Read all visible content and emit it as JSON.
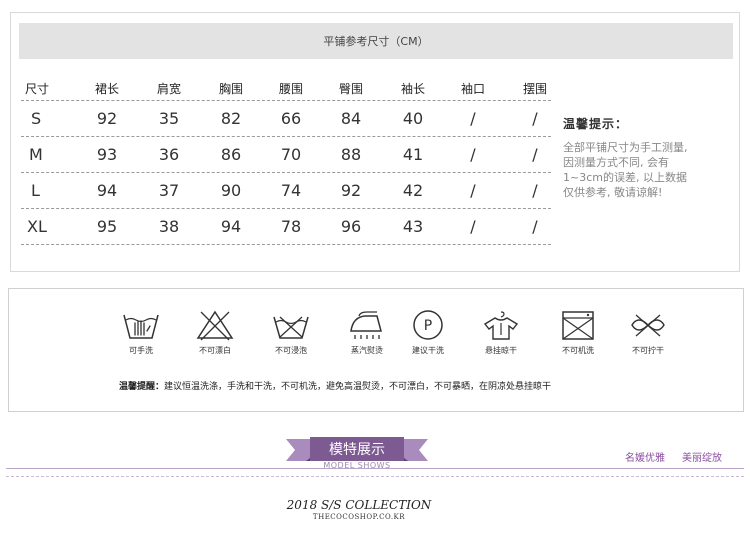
{
  "size_chart": {
    "title": "平铺参考尺寸（CM）",
    "headers": [
      "尺寸",
      "裙长",
      "肩宽",
      "胸围",
      "腰围",
      "臀围",
      "袖长",
      "袖口",
      "摆围"
    ],
    "rows": [
      [
        "S",
        "92",
        "35",
        "82",
        "66",
        "84",
        "40",
        "/",
        "/"
      ],
      [
        "M",
        "93",
        "36",
        "86",
        "70",
        "88",
        "41",
        "/",
        "/"
      ],
      [
        "L",
        "94",
        "37",
        "90",
        "74",
        "92",
        "42",
        "/",
        "/"
      ],
      [
        "XL",
        "95",
        "38",
        "94",
        "78",
        "96",
        "43",
        "/",
        "/"
      ]
    ]
  },
  "tip": {
    "title": "温馨提示：",
    "lines": [
      "全部平铺尺寸为手工测量,",
      "因测量方式不同, 会有",
      "1~3cm的误差, 以上数据",
      "仅供参考, 敬请谅解!"
    ]
  },
  "care": {
    "items": [
      {
        "icon": "hand-wash-icon",
        "label": "可手洗"
      },
      {
        "icon": "no-bleach-icon",
        "label": "不可漂白"
      },
      {
        "icon": "no-soak-icon",
        "label": "不可浸泡"
      },
      {
        "icon": "steam-iron-icon",
        "label": "蒸汽熨烫"
      },
      {
        "icon": "dry-clean-icon",
        "label": "建议干洗"
      },
      {
        "icon": "hang-dry-icon",
        "label": "悬挂晾干"
      },
      {
        "icon": "no-machine-wash-icon",
        "label": "不可机洗"
      },
      {
        "icon": "no-wring-icon",
        "label": "不可拧干"
      }
    ],
    "note_label": "温馨提醒：",
    "note_text": "建议恒温洗涤，手洗和干洗，不可机洗，避免高温熨烫，不可漂白，不可暴晒，在阴凉处悬挂晾干"
  },
  "banner": {
    "title": "模特展示",
    "subtitle": "MODEL SHOWS",
    "tag1": "名媛优雅",
    "tag2": "美丽绽放",
    "accent_color": "#7d5a91"
  },
  "footer": {
    "collection": "2018 S/S COLLECTION",
    "site": "THECOCOSHOP.CO.KR"
  }
}
